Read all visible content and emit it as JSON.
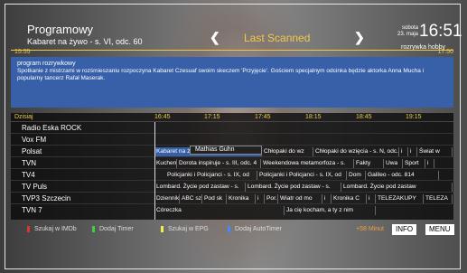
{
  "header": {
    "program_title": "Programowy",
    "program_sub": "Kabaret na żywo - s. VI, odc. 60",
    "mode": "Last Scanned",
    "date_line1": "sobota",
    "date_line2": "23. maja",
    "clock": "16:51",
    "genre": "rozrywka hobby",
    "time_start": "15:55",
    "time_end": "17:50"
  },
  "description": {
    "category": "program rozrywkowy",
    "text": "Spotkanie z mistrzami w rozśmieszaniu rozpoczyna Kabaret Czesuaf swoim skeczem 'Przyjęcie'. Gościem specjalnym odcinka będzie aktorka Anna Mucha i popularny tancerz Rafał Maserak."
  },
  "epg": {
    "today_label": "Dzisiaj",
    "times": [
      "16:45",
      "17:15",
      "17:45",
      "18:15",
      "18:45",
      "19:15"
    ],
    "tooltip": "Mathias Guhn",
    "channels": [
      {
        "name": "Radio Eska ROCK",
        "programs": []
      },
      {
        "name": "Vox FM",
        "programs": []
      },
      {
        "name": "Polsat",
        "programs": [
          "Kabaret na żywo - s. VI, odc. 60",
          "Chłopaki do wz",
          "Chłopaki do wzięcia - s. N, odc.",
          "i",
          "i",
          "Świat w"
        ]
      },
      {
        "name": "TVN",
        "programs": [
          "Kuchen",
          "Dorota inspiruje - s. III, odc. 4",
          "Weekendowa metamorfoza - s.",
          "Fakty",
          "Uwa",
          "Sport",
          "i"
        ]
      },
      {
        "name": "TV4",
        "programs": [
          "Policjanki i Policjanci - s. IX, od",
          "Policjanki i Policjanci - s. IX, od",
          "Dom",
          "Galileo - odc. 814"
        ]
      },
      {
        "name": "TV Puls",
        "programs": [
          "Lombard. Życie pod zastaw - s.",
          "Lombard. Życie pod zastaw - s.",
          "Lombard. Życie pod zastaw"
        ]
      },
      {
        "name": "TVP3 Szczecin",
        "programs": [
          "Dziennik",
          "ABC sz",
          "Pod sk",
          "Kronika",
          "i",
          "Por.",
          "Wiatr od mo",
          "i",
          "Kronika C",
          "i",
          "TELEZAKUPY",
          "TELEZA"
        ]
      },
      {
        "name": "TVN 7",
        "programs": [
          "Córeczka",
          "Ja cię kocham, a ty z nim"
        ]
      }
    ]
  },
  "footer": {
    "red": "Szukaj w IMDb",
    "green": "Dodaj Timer",
    "yellow": "Szukaj w EPG",
    "blue": "Dodaj AutoTimer",
    "minutes": "+58 Minut",
    "info": "INFO",
    "menu": "MENU"
  },
  "colors": {
    "accent": "#f0c94a",
    "selected": "#3760a8"
  }
}
